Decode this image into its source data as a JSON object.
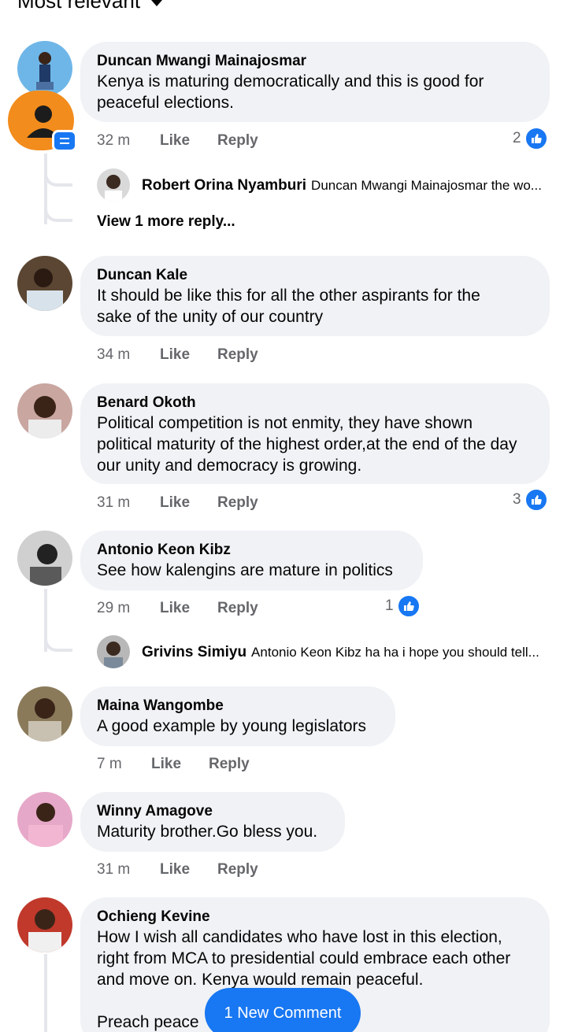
{
  "header": {
    "sort_label": "Most relevant"
  },
  "comments": [
    {
      "author": "Duncan Mwangi Mainajosmar",
      "text_lines": [
        "Kenya is maturing democratically and this is good for",
        "peaceful elections."
      ],
      "time": "32 m",
      "like": "Like",
      "reply": "Reply",
      "reactions": "2"
    },
    {
      "author": "Duncan Kale",
      "text_lines": [
        "It should be like this for all the other aspirants for the",
        "sake of the unity of our country"
      ],
      "time": "34 m",
      "like": "Like",
      "reply": "Reply"
    },
    {
      "author": "Benard Okoth",
      "text_lines": [
        "Political competition is not enmity, they have shown",
        "political maturity of the highest order,at the end of the day",
        "our unity and democracy is growing."
      ],
      "time": "31 m",
      "like": "Like",
      "reply": "Reply",
      "reactions": "3"
    },
    {
      "author": "Antonio Keon Kibz",
      "text_lines": [
        "See how kalengins are mature in politics"
      ],
      "time": "29 m",
      "like": "Like",
      "reply": "Reply",
      "reactions": "1"
    },
    {
      "author": "Maina Wangombe",
      "text_lines": [
        "A good example by young legislators"
      ],
      "time": "7 m",
      "like": "Like",
      "reply": "Reply"
    },
    {
      "author": "Winny Amagove",
      "text_lines": [
        "Maturity brother.Go bless you."
      ],
      "time": "31 m",
      "like": "Like",
      "reply": "Reply"
    },
    {
      "author": "Ochieng Kevine",
      "text_lines": [
        "How I wish all candidates who have lost in this election,",
        "right from MCA to presidential could embrace each other",
        "and move on. Kenya would remain peaceful.",
        "",
        "Preach peace"
      ]
    }
  ],
  "replies": [
    {
      "author": "Robert Orina Nyamburi",
      "preview": "Duncan Mwangi Mainajosmar the wo..."
    },
    {
      "author": "Grivins Simiyu",
      "preview": "Antonio Keon Kibz ha ha i hope you should tell..."
    }
  ],
  "view_more": "View 1 more reply...",
  "new_comment_button": "1 New Comment",
  "colors": {
    "accent": "#1877f2",
    "bubble": "#f0f2f5",
    "meta": "#65676b"
  },
  "icons": [
    "chevron-down-icon",
    "like-reaction-icon",
    "messenger-badge-icon"
  ]
}
